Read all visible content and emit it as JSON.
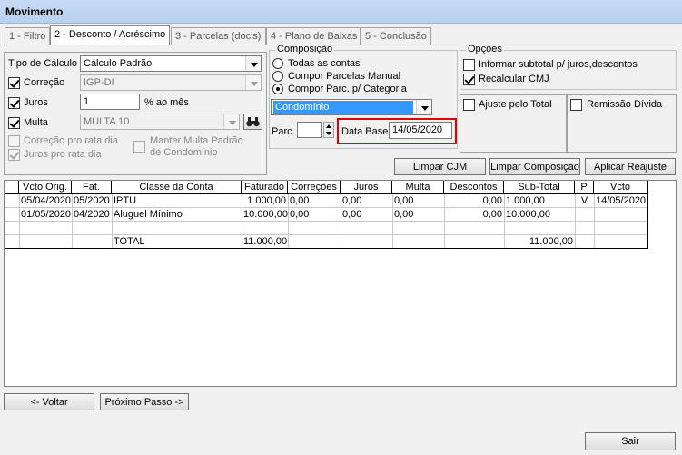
{
  "window": {
    "title": "Movimento"
  },
  "tabs": [
    {
      "label": "1 - Filtro"
    },
    {
      "label": "2 - Desconto / Acréscimo"
    },
    {
      "label": "3 - Parcelas (doc's)"
    },
    {
      "label": "4 - Plano de Baixas"
    },
    {
      "label": "5 - Conclusão"
    }
  ],
  "calc": {
    "tipo_label": "Tipo de Cálculo",
    "tipo_value": "Cálculo Padrão",
    "correcao_label": "Correção",
    "correcao_value": "IGP-DI",
    "juros_label": "Juros",
    "juros_value": "1",
    "juros_unit": "% ao mês",
    "multa_label": "Multa",
    "multa_value": "MULTA 10",
    "correcao_pro_rata": "Correção pro rata dia",
    "juros_pro_rata": "Juros pro rata dia",
    "manter_multa_l1": "Manter Multa Padrão",
    "manter_multa_l2": "de Condomínio"
  },
  "composicao": {
    "legend": "Composição",
    "opt1": "Todas as contas",
    "opt2": "Compor Parcelas Manual",
    "opt3": "Compor Parc. p/ Categoria",
    "categoria": "Condomínio",
    "parc_label": "Parc.",
    "parc_value": "",
    "data_base_label": "Data Base",
    "data_base_value": "14/05/2020"
  },
  "opcoes": {
    "legend": "Opções",
    "informar": "Informar subtotal p/ juros,descontos",
    "recalcular": "Recalcular CMJ",
    "ajuste": "Ajuste pelo Total",
    "remissao": "Remissão Dívida"
  },
  "buttons": {
    "limpar_cjm": "Limpar CJM",
    "limpar_composicao": "Limpar Composição",
    "aplicar_reajuste": "Aplicar Reajuste",
    "voltar": "<- Voltar",
    "proximo": "Próximo Passo ->",
    "sair": "Sair"
  },
  "table": {
    "headers": [
      "Vcto Orig.",
      "Fat.",
      "Classe da Conta",
      "Faturado",
      "Correções",
      "Juros",
      "Multa",
      "Descontos",
      "Sub-Total",
      "P",
      "Vcto"
    ],
    "rows": [
      [
        "05/04/2020",
        "05/2020",
        "IPTU",
        "1.000,00",
        "0,00",
        "0,00",
        "0,00",
        "0,00",
        "1.000,00",
        "V",
        "14/05/2020"
      ],
      [
        "01/05/2020",
        "04/2020",
        "Aluguel Mínimo",
        "10.000,00",
        "0,00",
        "0,00",
        "0,00",
        "0,00",
        "10.000,00",
        "",
        ""
      ],
      [
        "",
        "",
        "",
        "",
        "",
        "",
        "",
        "",
        "",
        "",
        ""
      ],
      [
        "",
        "",
        "TOTAL",
        "11.000,00",
        "",
        "",
        "",
        "",
        "11.000,00",
        "",
        ""
      ]
    ]
  },
  "colors": {
    "highlight_box": "#e00000",
    "selection": "#3399ff"
  }
}
